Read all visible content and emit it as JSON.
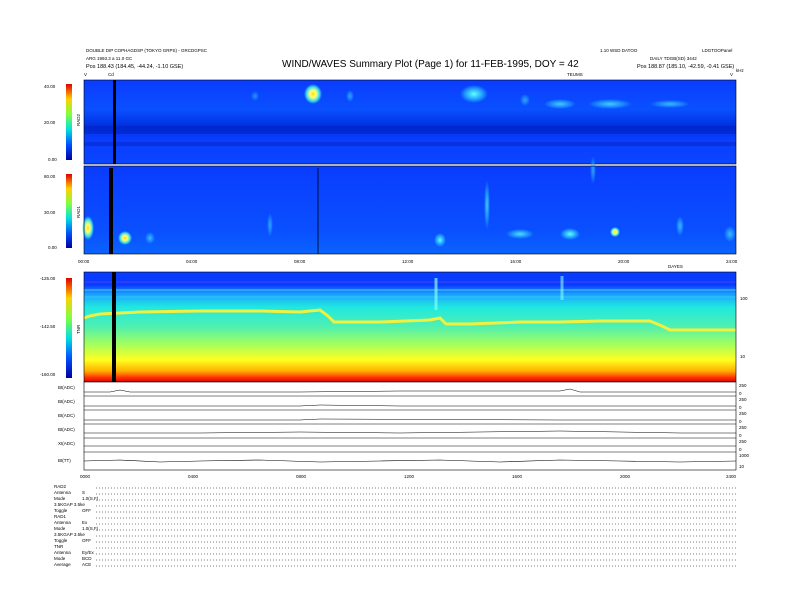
{
  "header": {
    "left_line1": "DOUBLE DIP COPHAGDSP (TOKYO GRPS) - GRCDGPSC",
    "left_line2": "ARG 1993.3 a 11.0 GC",
    "left_line3": "Pos   188.43 (184.45, -44.24, -1.10 GSE)",
    "title": "WIND/WAVES Summary Plot (Page 1) for 11-FEB-1995, DOY = 42",
    "right_line1": "1.10 WSD DATOO",
    "right_line1b": "LDGTOOPanel",
    "right_line2": "DAILY TDGB(SD) 3442",
    "right_line3": "Pos   188.87 (185.10, -42.59, -0.41 GSE)",
    "markers": {
      "left_a": "V",
      "left_b": "Cd",
      "mid": "TEUMS",
      "right_a": "V",
      "right_b": "kHz"
    }
  },
  "chart_data": [
    {
      "type": "heatmap",
      "panel": "RAD2",
      "ylabel": "RAD2",
      "y_ticks": [
        "40.00",
        "20.00",
        "0.00"
      ],
      "colormap": "jet"
    },
    {
      "type": "heatmap",
      "panel": "RAD1",
      "ylabel": "RAD1",
      "y_ticks": [
        "80.00",
        "30.00",
        "0.00"
      ],
      "x_ticks": [
        "00:00",
        "04:00",
        "08:00",
        "12:00",
        "16:00",
        "20:00",
        "24:00"
      ],
      "x_extra_label": "DAYES",
      "colormap": "jet"
    },
    {
      "type": "heatmap",
      "panel": "TNR",
      "ylabel": "TNR",
      "y_ticks": [
        "-125.00",
        "-142.50",
        "-160.00"
      ],
      "right_ticks": [
        "100",
        "10"
      ],
      "colormap": "jet"
    },
    {
      "type": "line",
      "panel": "ancillary",
      "labels": [
        "Bt(ADC)",
        "Bt(ADC)",
        "Bt(ADC)",
        "Bt(ADC)",
        "Xt(ADC)",
        "Bt(TT)"
      ],
      "right_ticks": [
        [
          "250",
          "0"
        ],
        [
          "250",
          "0"
        ],
        [
          "250",
          "0"
        ],
        [
          "250",
          "0"
        ],
        [
          "250",
          "0"
        ],
        [
          "1000",
          "10"
        ]
      ],
      "x_ticks": [
        "0000",
        "0400",
        "0800",
        "1200",
        "1600",
        "2000",
        "2400"
      ]
    }
  ],
  "footer": {
    "rows": [
      {
        "a": "RAD2",
        "b": ""
      },
      {
        "a": "Antenna",
        "b": "S"
      },
      {
        "a": "Mode",
        "b": "1.0(S,F)"
      },
      {
        "a": "3.5KGAP 3.5ke",
        "b": ""
      },
      {
        "a": "Toggle",
        "b": "OFF"
      },
      {
        "a": "RAD1",
        "b": ""
      },
      {
        "a": "Antenna",
        "b": "Ex"
      },
      {
        "a": "Mode",
        "b": "1.0(S,F)"
      },
      {
        "a": "3.5KGAP 3.5ke",
        "b": ""
      },
      {
        "a": "Toggle",
        "b": "OFF"
      },
      {
        "a": "TNR",
        "b": ""
      },
      {
        "a": "Antenna",
        "b": "Ey/Ex"
      },
      {
        "a": "Mode",
        "b": "BCD"
      },
      {
        "a": "Average",
        "b": "ACE"
      }
    ]
  }
}
